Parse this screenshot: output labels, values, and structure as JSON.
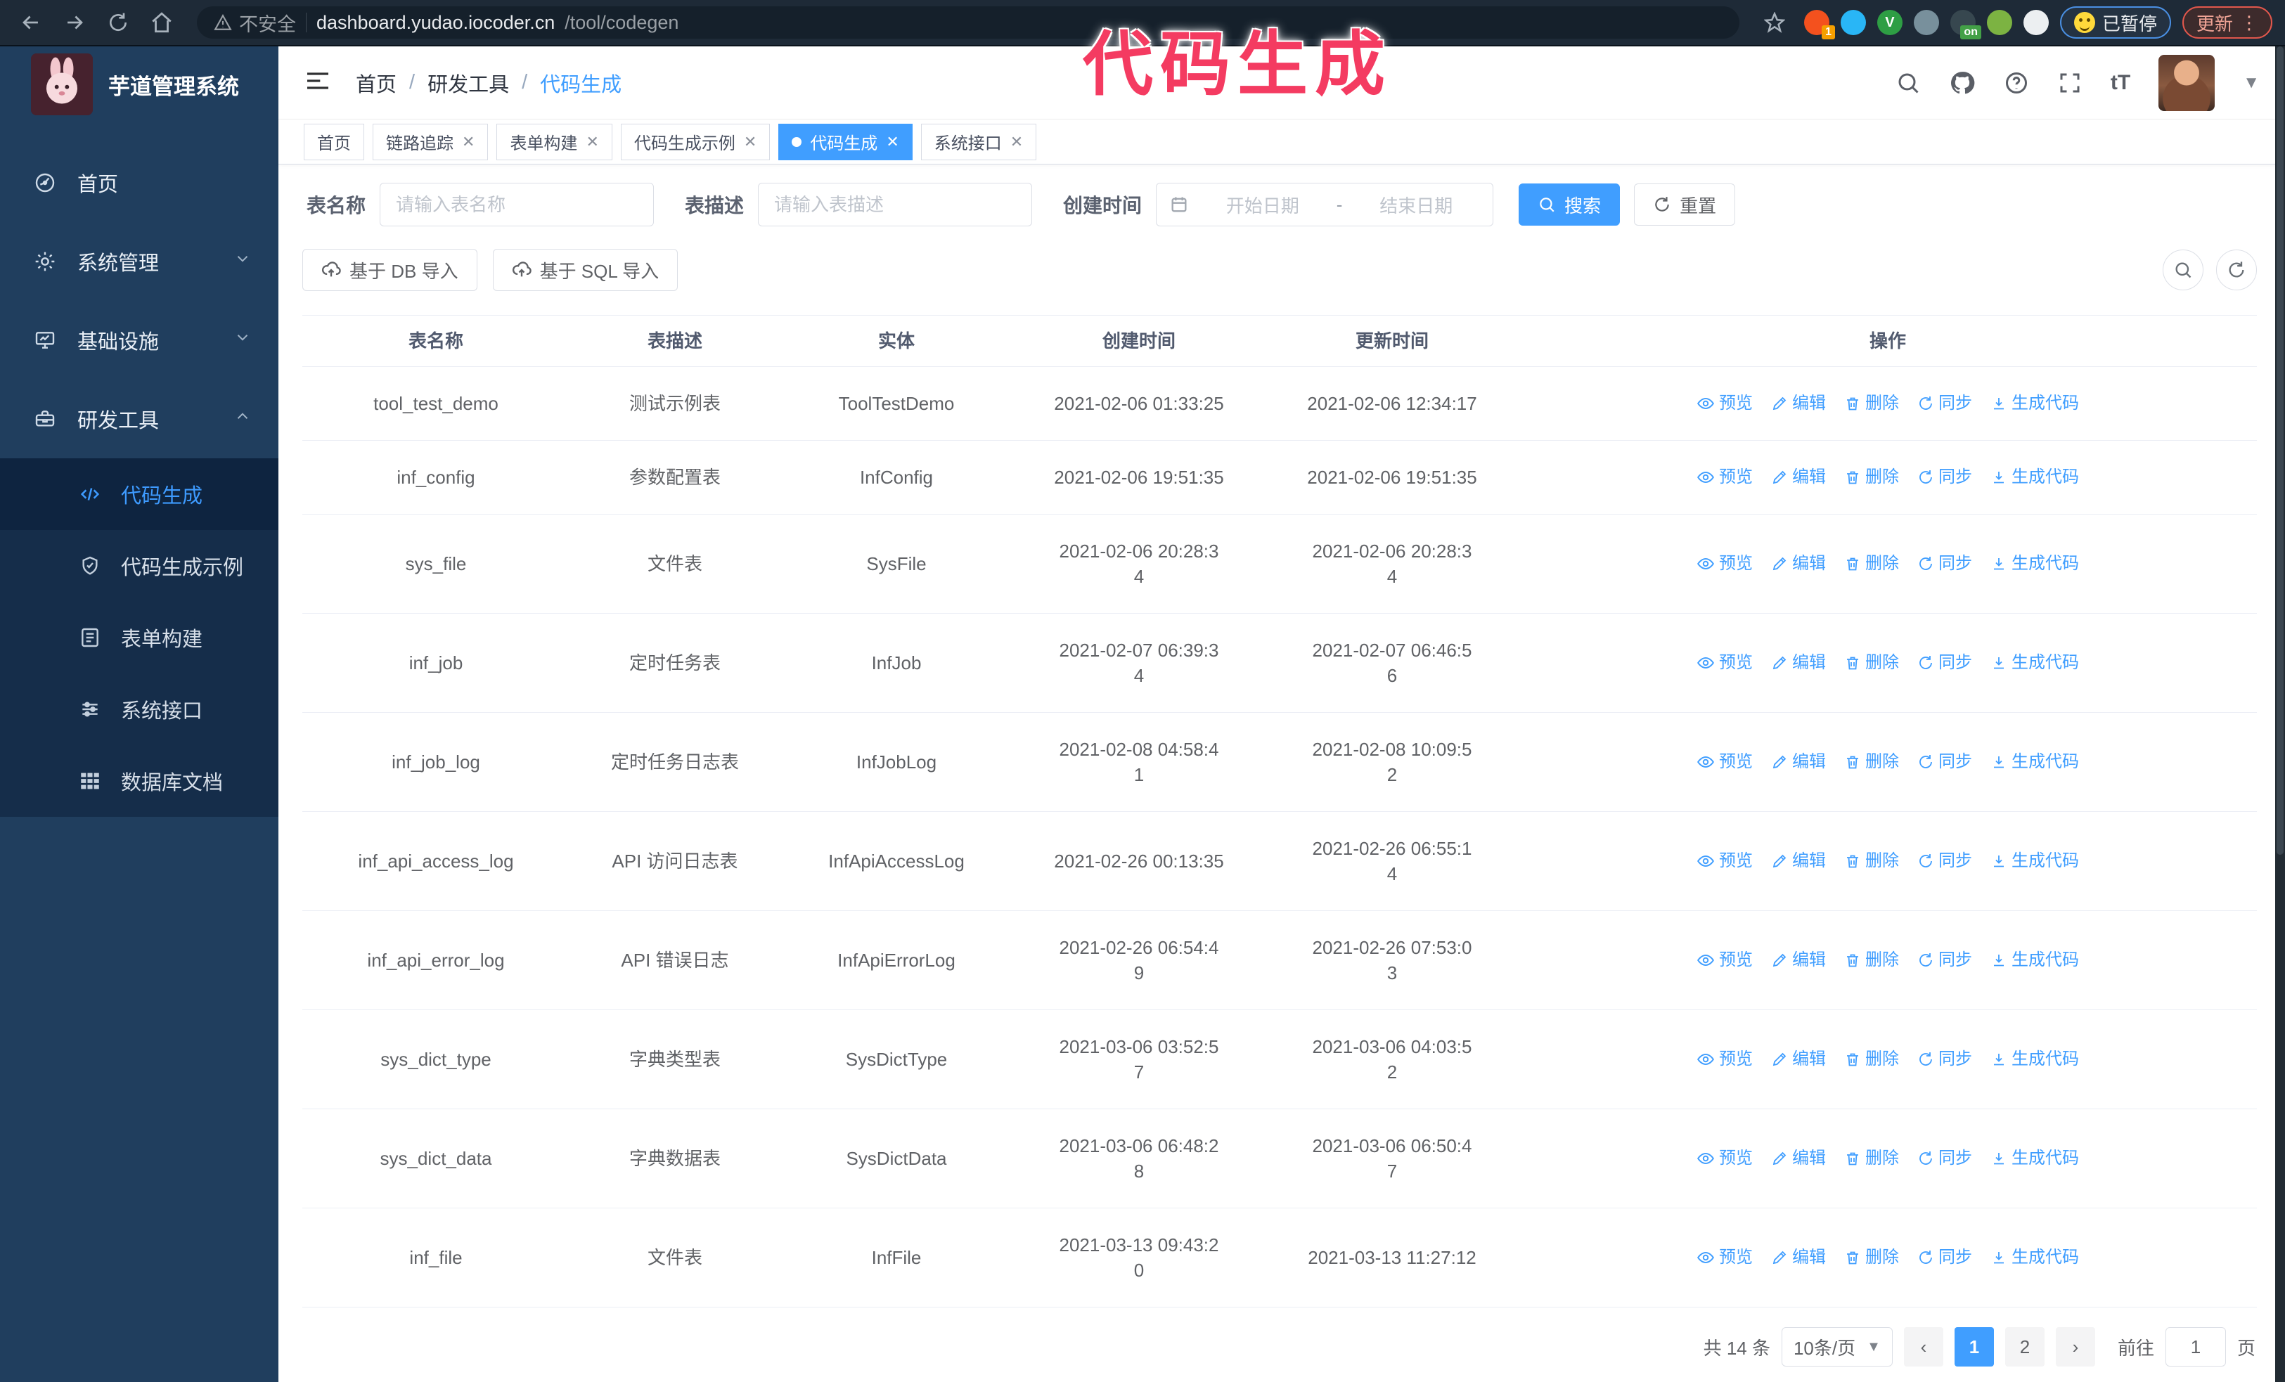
{
  "browser": {
    "security_label": "不安全",
    "url_host": "dashboard.yudao.iocoder.cn",
    "url_path": "/tool/codegen",
    "paused_badge": "已暂停",
    "update_badge": "更新",
    "extensions": [
      {
        "name": "orange-extension-icon",
        "color": "#f4511e",
        "badge": "1"
      },
      {
        "name": "blue-gem-extension-icon",
        "color": "#29b6f6",
        "badge": ""
      },
      {
        "name": "green-v-extension-icon",
        "color": "#2e9e44",
        "badge": "V"
      },
      {
        "name": "gray-drop-extension-icon",
        "color": "#78909c",
        "badge": ""
      },
      {
        "name": "on-extension-icon",
        "color": "#37474f",
        "badge": "on"
      },
      {
        "name": "frog-extension-icon",
        "color": "#7cb342",
        "badge": ""
      },
      {
        "name": "puzzle-extension-icon",
        "color": "#eceff1",
        "badge": ""
      }
    ]
  },
  "annotation": {
    "text": "代码生成",
    "color": "#f43b61"
  },
  "sidebar": {
    "logo_title": "芋道管理系统",
    "items": [
      {
        "label": "首页",
        "icon": "home",
        "chevron": ""
      },
      {
        "label": "系统管理",
        "icon": "gear",
        "chevron": "down"
      },
      {
        "label": "基础设施",
        "icon": "monitor",
        "chevron": "down"
      },
      {
        "label": "研发工具",
        "icon": "toolbox",
        "chevron": "up"
      }
    ],
    "submenu": [
      {
        "label": "代码生成",
        "icon": "code",
        "active": true
      },
      {
        "label": "代码生成示例",
        "icon": "shield",
        "active": false
      },
      {
        "label": "表单构建",
        "icon": "form",
        "active": false
      },
      {
        "label": "系统接口",
        "icon": "sliders",
        "active": false
      },
      {
        "label": "数据库文档",
        "icon": "grid",
        "active": false
      }
    ]
  },
  "header": {
    "breadcrumb": [
      {
        "label": "首页",
        "current": false
      },
      {
        "label": "研发工具",
        "current": false
      },
      {
        "label": "代码生成",
        "current": true
      }
    ]
  },
  "tabs": [
    {
      "label": "首页",
      "closable": false,
      "active": false
    },
    {
      "label": "链路追踪",
      "closable": true,
      "active": false
    },
    {
      "label": "表单构建",
      "closable": true,
      "active": false
    },
    {
      "label": "代码生成示例",
      "closable": true,
      "active": false
    },
    {
      "label": "代码生成",
      "closable": true,
      "active": true
    },
    {
      "label": "系统接口",
      "closable": true,
      "active": false
    }
  ],
  "filter": {
    "name_label": "表名称",
    "name_placeholder": "请输入表名称",
    "desc_label": "表描述",
    "desc_placeholder": "请输入表描述",
    "time_label": "创建时间",
    "start_placeholder": "开始日期",
    "range_separator": "-",
    "end_placeholder": "结束日期",
    "search_label": "搜索",
    "reset_label": "重置"
  },
  "toolbar": {
    "db_import_label": "基于 DB 导入",
    "sql_import_label": "基于 SQL 导入"
  },
  "table": {
    "columns": [
      "表名称",
      "表描述",
      "实体",
      "创建时间",
      "更新时间",
      "操作"
    ],
    "actions": [
      {
        "label": "预览",
        "icon": "eye"
      },
      {
        "label": "编辑",
        "icon": "pen"
      },
      {
        "label": "删除",
        "icon": "trash"
      },
      {
        "label": "同步",
        "icon": "sync"
      },
      {
        "label": "生成代码",
        "icon": "download"
      }
    ],
    "rows": [
      {
        "name": "tool_test_demo",
        "desc": "测试示例表",
        "entity": "ToolTestDemo",
        "created": "2021-02-06 01:33:25",
        "created_wrap": false,
        "updated": "2021-02-06 12:34:17",
        "updated_wrap": false
      },
      {
        "name": "inf_config",
        "desc": "参数配置表",
        "entity": "InfConfig",
        "created": "2021-02-06 19:51:35",
        "created_wrap": false,
        "updated": "2021-02-06 19:51:35",
        "updated_wrap": false
      },
      {
        "name": "sys_file",
        "desc": "文件表",
        "entity": "SysFile",
        "created": "2021-02-06 20:28:34",
        "created_wrap": true,
        "updated": "2021-02-06 20:28:34",
        "updated_wrap": true
      },
      {
        "name": "inf_job",
        "desc": "定时任务表",
        "entity": "InfJob",
        "created": "2021-02-07 06:39:34",
        "created_wrap": true,
        "updated": "2021-02-07 06:46:56",
        "updated_wrap": true
      },
      {
        "name": "inf_job_log",
        "desc": "定时任务日志表",
        "entity": "InfJobLog",
        "created": "2021-02-08 04:58:41",
        "created_wrap": true,
        "updated": "2021-02-08 10:09:52",
        "updated_wrap": true
      },
      {
        "name": "inf_api_access_log",
        "desc": "API 访问日志表",
        "entity": "InfApiAccessLog",
        "created": "2021-02-26 00:13:35",
        "created_wrap": false,
        "updated": "2021-02-26 06:55:14",
        "updated_wrap": true
      },
      {
        "name": "inf_api_error_log",
        "desc": "API 错误日志",
        "entity": "InfApiErrorLog",
        "created": "2021-02-26 06:54:49",
        "created_wrap": true,
        "updated": "2021-02-26 07:53:03",
        "updated_wrap": true
      },
      {
        "name": "sys_dict_type",
        "desc": "字典类型表",
        "entity": "SysDictType",
        "created": "2021-03-06 03:52:57",
        "created_wrap": true,
        "updated": "2021-03-06 04:03:52",
        "updated_wrap": true
      },
      {
        "name": "sys_dict_data",
        "desc": "字典数据表",
        "entity": "SysDictData",
        "created": "2021-03-06 06:48:28",
        "created_wrap": true,
        "updated": "2021-03-06 06:50:47",
        "updated_wrap": true
      },
      {
        "name": "inf_file",
        "desc": "文件表",
        "entity": "InfFile",
        "created": "2021-03-13 09:43:20",
        "created_wrap": true,
        "updated": "2021-03-13 11:27:12",
        "updated_wrap": false
      }
    ]
  },
  "pagination": {
    "total_text": "共 14 条",
    "page_size": "10条/页",
    "pages": [
      "1",
      "2"
    ],
    "current_page": "1",
    "goto_label": "前往",
    "goto_value": "1",
    "page_suffix": "页"
  }
}
